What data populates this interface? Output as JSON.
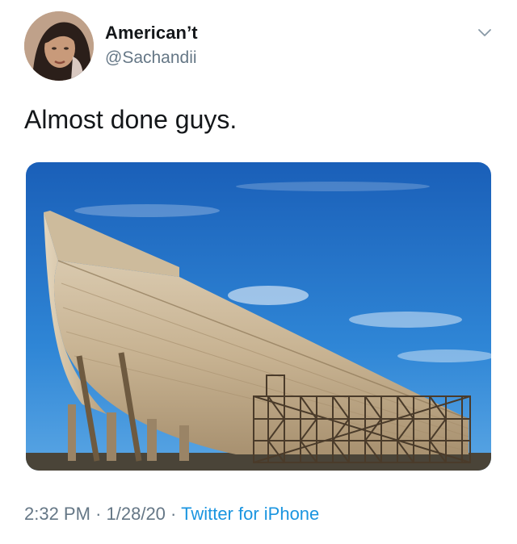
{
  "tweet": {
    "author": {
      "display_name": "American’t",
      "handle": "@Sachandii"
    },
    "text": "Almost done guys.",
    "timestamp_time": "2:32 PM",
    "separator": "·",
    "timestamp_date": "1/28/20",
    "source": "Twitter for iPhone"
  },
  "icons": {
    "menu": "chevron-down-icon"
  },
  "colors": {
    "text_primary": "#14171a",
    "text_secondary": "#657786",
    "link": "#1b95e0",
    "sky": "#1f72c8"
  }
}
